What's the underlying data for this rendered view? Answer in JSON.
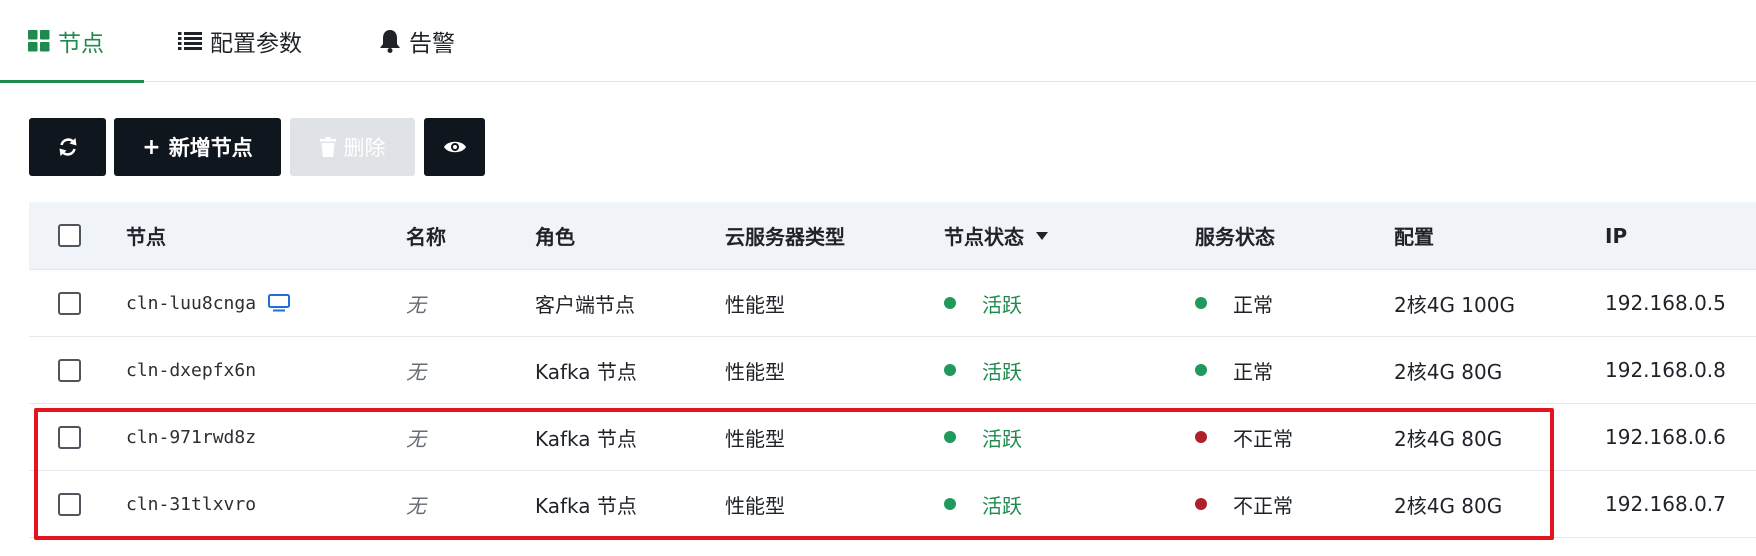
{
  "tabs": [
    {
      "label": "节点",
      "icon": "grid-icon",
      "active": true
    },
    {
      "label": "配置参数",
      "icon": "list-icon",
      "active": false
    },
    {
      "label": "告警",
      "icon": "bell-icon",
      "active": false
    }
  ],
  "toolbar": {
    "refresh_icon": "refresh-icon",
    "add_label": "新增节点",
    "delete_label": "删除",
    "view_icon": "eye-icon"
  },
  "table": {
    "headers": {
      "node": "节点",
      "name": "名称",
      "role": "角色",
      "server_type": "云服务器类型",
      "node_status": "节点状态",
      "service_status": "服务状态",
      "config": "配置",
      "ip": "IP"
    },
    "rows": [
      {
        "node": "cln-luu8cnga",
        "name": "无",
        "role": "客户端节点",
        "server_type": "性能型",
        "node_status": "活跃",
        "service_status": "正常",
        "config": "2核4G 100G",
        "ip": "192.168.0.5",
        "service_ok": true
      },
      {
        "node": "cln-dxepfx6n",
        "name": "无",
        "role": "Kafka 节点",
        "server_type": "性能型",
        "node_status": "活跃",
        "service_status": "正常",
        "config": "2核4G 80G",
        "ip": "192.168.0.8",
        "service_ok": true
      },
      {
        "node": "cln-971rwd8z",
        "name": "无",
        "role": "Kafka 节点",
        "server_type": "性能型",
        "node_status": "活跃",
        "service_status": "不正常",
        "config": "2核4G 80G",
        "ip": "192.168.0.6",
        "service_ok": false
      },
      {
        "node": "cln-31tlxvro",
        "name": "无",
        "role": "Kafka 节点",
        "server_type": "性能型",
        "node_status": "活跃",
        "service_status": "不正常",
        "config": "2核4G 80G",
        "ip": "192.168.0.7",
        "service_ok": false
      }
    ]
  },
  "colors": {
    "accent_green": "#1f8a4c",
    "status_ok": "#1f9a5c",
    "status_bad": "#b0202a",
    "highlight_border": "#e3141e",
    "button_dark": "#10161d"
  }
}
